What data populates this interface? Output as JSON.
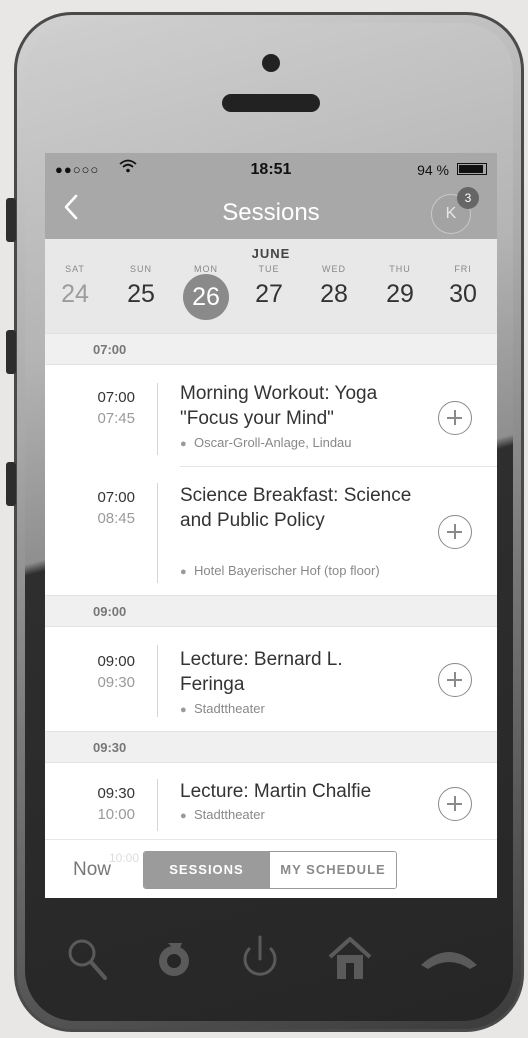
{
  "status": {
    "signal": "●●○○○",
    "time": "18:51",
    "battery": "94 %",
    "battery_level": 0.94
  },
  "nav": {
    "title": "Sessions",
    "back_icon": "chevron-left-icon",
    "avatar_initial": "K",
    "badge_count": "3"
  },
  "calendar": {
    "month": "JUNE",
    "days": [
      {
        "dow": "SAT",
        "num": "24",
        "state": "past"
      },
      {
        "dow": "SUN",
        "num": "25",
        "state": "normal"
      },
      {
        "dow": "MON",
        "num": "26",
        "state": "selected"
      },
      {
        "dow": "TUE",
        "num": "27",
        "state": "normal"
      },
      {
        "dow": "WED",
        "num": "28",
        "state": "normal"
      },
      {
        "dow": "THU",
        "num": "29",
        "state": "normal"
      },
      {
        "dow": "FRI",
        "num": "30",
        "state": "normal"
      }
    ]
  },
  "sections": [
    {
      "time": "07:00"
    },
    {
      "time": "09:00"
    },
    {
      "time": "09:30"
    }
  ],
  "sessions": [
    {
      "start": "07:00",
      "end": "07:45",
      "title": "Morning Workout: Yoga \"Focus your Mind\"",
      "location": "Oscar-Groll-Anlage, Lindau"
    },
    {
      "start": "07:00",
      "end": "08:45",
      "title": "Science Breakfast: Science and Public Policy",
      "location": "Hotel Bayerischer Hof (top floor)"
    },
    {
      "start": "09:00",
      "end": "09:30",
      "title": "Lecture: Bernard L. Feringa",
      "location": "Stadttheater"
    },
    {
      "start": "09:30",
      "end": "10:00",
      "title": "Lecture: Martin Chalfie",
      "location": "Stadttheater"
    }
  ],
  "footer": {
    "now_label": "Now",
    "ghost_time": "10:00",
    "tab_sessions": "SESSIONS",
    "tab_schedule": "MY SCHEDULE"
  },
  "dock": {
    "icons": [
      "search-icon",
      "refresh-icon",
      "power-icon",
      "home-icon",
      "phone-hangup-icon"
    ]
  }
}
